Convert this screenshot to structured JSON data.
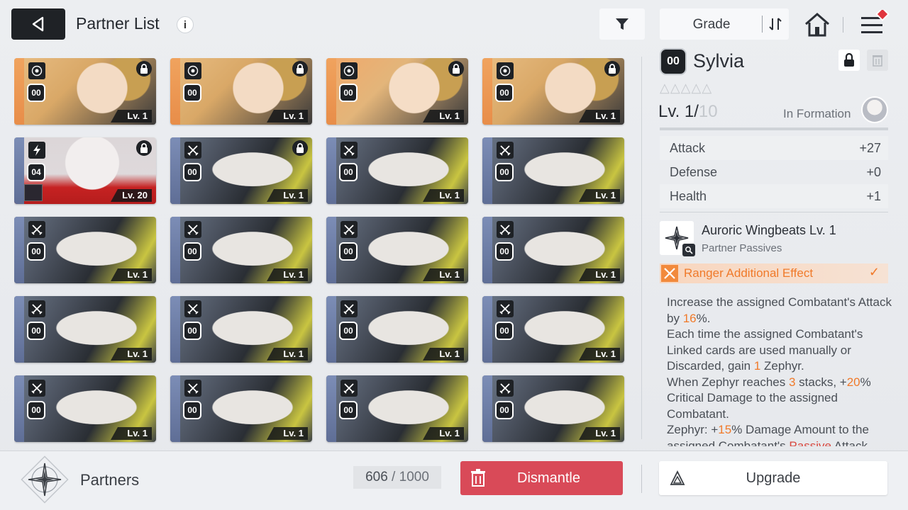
{
  "header": {
    "title": "Partner List",
    "info_glyph": "i",
    "sort_label": "Grade"
  },
  "cards": [
    {
      "style": "gold",
      "type_icon": "target-icon",
      "rank": "00",
      "locked": true,
      "level": "Lv. 1",
      "hl": false
    },
    {
      "style": "gold",
      "type_icon": "target-icon",
      "rank": "00",
      "locked": true,
      "level": "Lv. 1",
      "hl": false
    },
    {
      "style": "gold",
      "type_icon": "target-icon",
      "rank": "00",
      "locked": true,
      "level": "Lv. 1",
      "hl": true
    },
    {
      "style": "gold",
      "type_icon": "target-icon",
      "rank": "00",
      "locked": true,
      "level": "Lv. 1",
      "hl": false
    },
    {
      "style": "red",
      "type_icon": "lightning-icon",
      "rank": "04",
      "locked": true,
      "level": "Lv. 20",
      "hl": false,
      "avatar": true
    },
    {
      "style": "blue",
      "type_icon": "crossed-swords-icon",
      "rank": "00",
      "locked": true,
      "level": "Lv. 1",
      "hl": false
    },
    {
      "style": "blue",
      "type_icon": "crossed-swords-icon",
      "rank": "00",
      "locked": false,
      "level": "Lv. 1",
      "hl": false
    },
    {
      "style": "blue",
      "type_icon": "crossed-swords-icon",
      "rank": "00",
      "locked": false,
      "level": "Lv. 1",
      "hl": false
    },
    {
      "style": "blue",
      "type_icon": "crossed-swords-icon",
      "rank": "00",
      "locked": false,
      "level": "Lv. 1",
      "hl": false
    },
    {
      "style": "blue",
      "type_icon": "crossed-swords-icon",
      "rank": "00",
      "locked": false,
      "level": "Lv. 1",
      "hl": false
    },
    {
      "style": "blue",
      "type_icon": "crossed-swords-icon",
      "rank": "00",
      "locked": false,
      "level": "Lv. 1",
      "hl": false
    },
    {
      "style": "blue",
      "type_icon": "crossed-swords-icon",
      "rank": "00",
      "locked": false,
      "level": "Lv. 1",
      "hl": false
    },
    {
      "style": "blue",
      "type_icon": "crossed-swords-icon",
      "rank": "00",
      "locked": false,
      "level": "Lv. 1",
      "hl": false
    },
    {
      "style": "blue",
      "type_icon": "crossed-swords-icon",
      "rank": "00",
      "locked": false,
      "level": "Lv. 1",
      "hl": false
    },
    {
      "style": "blue",
      "type_icon": "crossed-swords-icon",
      "rank": "00",
      "locked": false,
      "level": "Lv. 1",
      "hl": false
    },
    {
      "style": "blue",
      "type_icon": "crossed-swords-icon",
      "rank": "00",
      "locked": false,
      "level": "Lv. 1",
      "hl": false
    },
    {
      "style": "blue",
      "type_icon": "crossed-swords-icon",
      "rank": "00",
      "locked": false,
      "level": "Lv. 1",
      "hl": false
    },
    {
      "style": "blue",
      "type_icon": "crossed-swords-icon",
      "rank": "00",
      "locked": false,
      "level": "Lv. 1",
      "hl": false
    },
    {
      "style": "blue",
      "type_icon": "crossed-swords-icon",
      "rank": "00",
      "locked": false,
      "level": "Lv. 1",
      "hl": false
    },
    {
      "style": "blue",
      "type_icon": "crossed-swords-icon",
      "rank": "00",
      "locked": false,
      "level": "Lv. 1",
      "hl": false
    }
  ],
  "detail": {
    "rank": "00",
    "name": "Sylvia",
    "stars": "△△△△△",
    "level_current": "Lv. 1/",
    "level_max": "10",
    "in_formation": "In Formation",
    "stats": [
      {
        "label": "Attack",
        "value": "+27"
      },
      {
        "label": "Defense",
        "value": "+0"
      },
      {
        "label": "Health",
        "value": "+1"
      }
    ],
    "skill_name": "Auroric Wingbeats Lv. 1",
    "skill_sub": "Partner Passives",
    "effect_label": "Ranger Additional Effect",
    "effect_check": "✓",
    "desc": {
      "p1_a": "Increase the assigned Combatant's Attack by ",
      "p1_hl": "16",
      "p1_b": "%.",
      "p2_a": "Each time the assigned Combatant's Linked cards are used manually or Discarded, gain ",
      "p2_hl": "1",
      "p2_b": " Zephyr.",
      "p3_a": "When Zephyr reaches ",
      "p3_hl": "3",
      "p3_b": " stacks, +",
      "p3_hl2": "20",
      "p3_c": "% Critical Damage to the assigned Combatant.",
      "p4_a": "Zephyr: +",
      "p4_hl": "15",
      "p4_b": "% Damage Amount to the assigned Combatant's ",
      "p4_red": "Passive",
      "p4_c": " Attack"
    }
  },
  "bottom": {
    "partners_label": "Partners",
    "capacity_current": "606",
    "capacity_sep": " / ",
    "capacity_max": "1000",
    "dismantle_label": "Dismantle",
    "upgrade_label": "Upgrade"
  },
  "colors": {
    "accent_orange": "#f07a2a",
    "dismantle_red": "#d94a58",
    "dark": "#1e2125"
  }
}
